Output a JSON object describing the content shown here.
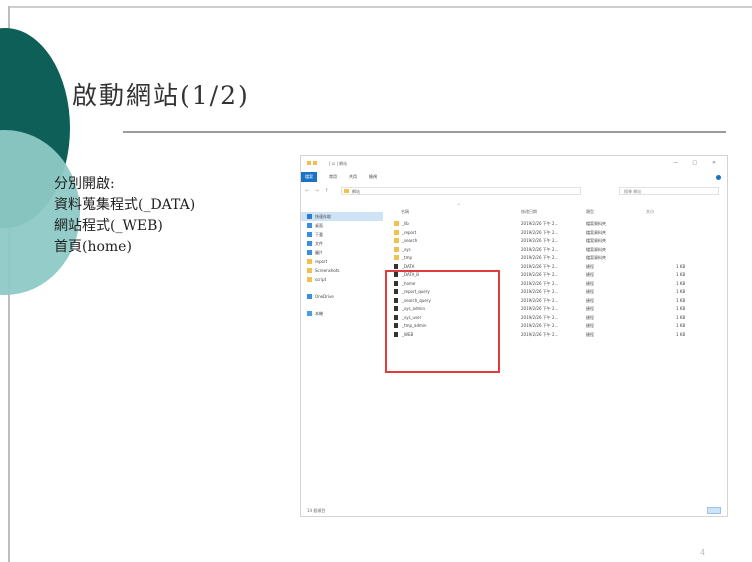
{
  "slide": {
    "title": "啟動網站(1/2)",
    "body_lines": [
      "分別開啟:",
      "資料蒐集程式(_DATA)",
      "網站程式(_WEB)",
      "首頁(home)"
    ],
    "page_number": "4"
  },
  "colors": {
    "circle_dark": "#0e5f57",
    "circle_light": "#8ec9c6",
    "highlight": "#e23b3b",
    "accent_blue": "#1a73c7"
  },
  "explorer": {
    "title": "| ☑ | 網站",
    "window_buttons": [
      "—",
      "□",
      "✕"
    ],
    "ribbon_tabs": [
      "檔案",
      "常用",
      "共用",
      "檢視"
    ],
    "nav_arrows": "← → ↑",
    "address": "網站",
    "search_placeholder": "搜尋 網站",
    "columns": [
      "名稱",
      "修改日期",
      "類型",
      "大小"
    ],
    "nav_items": [
      {
        "label": "快速存取",
        "icon": "star-icon"
      },
      {
        "label": "桌面",
        "icon": "desktop-icon"
      },
      {
        "label": "下載",
        "icon": "download-icon"
      },
      {
        "label": "文件",
        "icon": "document-icon"
      },
      {
        "label": "圖片",
        "icon": "picture-icon"
      },
      {
        "label": "report",
        "icon": "folder-icon"
      },
      {
        "label": "Screenshots",
        "icon": "folder-icon"
      },
      {
        "label": "script",
        "icon": "folder-icon"
      },
      {
        "label": "OneDrive",
        "icon": "cloud-icon"
      },
      {
        "label": "本機",
        "icon": "pc-icon"
      }
    ],
    "files": [
      {
        "name": "_lib",
        "date": "2019/2/26 下午 2...",
        "type": "檔案資料夾",
        "size": "",
        "kind": "folder"
      },
      {
        "name": "_report",
        "date": "2019/2/26 下午 2...",
        "type": "檔案資料夾",
        "size": "",
        "kind": "folder"
      },
      {
        "name": "_search",
        "date": "2019/2/26 下午 2...",
        "type": "檔案資料夾",
        "size": "",
        "kind": "folder"
      },
      {
        "name": "_sys",
        "date": "2019/2/26 下午 2...",
        "type": "檔案資料夾",
        "size": "",
        "kind": "folder"
      },
      {
        "name": "_tmp",
        "date": "2019/2/26 下午 2...",
        "type": "檔案資料夾",
        "size": "",
        "kind": "folder"
      },
      {
        "name": "_DATA",
        "date": "2019/2/26 下午 2...",
        "type": "捷徑",
        "size": "1 KB",
        "kind": "file"
      },
      {
        "name": "_DATA_B",
        "date": "2019/2/26 下午 2...",
        "type": "捷徑",
        "size": "1 KB",
        "kind": "file"
      },
      {
        "name": "_home",
        "date": "2019/2/26 下午 2...",
        "type": "捷徑",
        "size": "1 KB",
        "kind": "file"
      },
      {
        "name": "_report_query",
        "date": "2019/2/26 下午 2...",
        "type": "捷徑",
        "size": "1 KB",
        "kind": "file"
      },
      {
        "name": "_search_query",
        "date": "2019/2/26 下午 2...",
        "type": "捷徑",
        "size": "1 KB",
        "kind": "file"
      },
      {
        "name": "_sys_admin",
        "date": "2019/2/26 下午 2...",
        "type": "捷徑",
        "size": "1 KB",
        "kind": "file"
      },
      {
        "name": "_sys_user",
        "date": "2019/2/26 下午 2...",
        "type": "捷徑",
        "size": "1 KB",
        "kind": "file"
      },
      {
        "name": "_tmp_admin",
        "date": "2019/2/26 下午 2...",
        "type": "捷徑",
        "size": "1 KB",
        "kind": "file"
      },
      {
        "name": "_WEB",
        "date": "2019/2/26 下午 2...",
        "type": "捷徑",
        "size": "1 KB",
        "kind": "file"
      }
    ],
    "status": "14 個項目"
  }
}
